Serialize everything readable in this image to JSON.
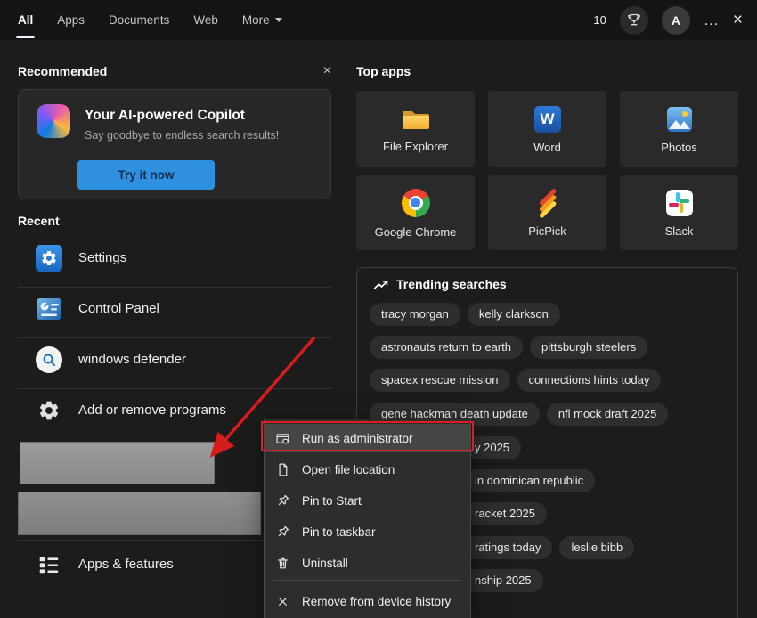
{
  "topbar": {
    "tabs": [
      "All",
      "Apps",
      "Documents",
      "Web",
      "More"
    ],
    "rewards_count": "10",
    "avatar_letter": "A",
    "ellipsis_glyph": "…",
    "close_glyph": "×"
  },
  "left": {
    "recommended_title": "Recommended",
    "recommended_close_glyph": "×",
    "copilot": {
      "title": "Your AI-powered Copilot",
      "subtitle": "Say goodbye to endless search results!",
      "button_label": "Try it now"
    },
    "recent_title": "Recent",
    "recent_items": [
      {
        "label": "Settings",
        "icon": "settings-icon"
      },
      {
        "label": "Control Panel",
        "icon": "control-panel-icon"
      },
      {
        "label": "windows defender",
        "icon": "search-icon"
      },
      {
        "label": "Add or remove programs",
        "icon": "gear-icon"
      }
    ],
    "apps_features_label": "Apps & features"
  },
  "right": {
    "top_apps_title": "Top apps",
    "apps": [
      {
        "label": "File Explorer",
        "icon": "folder-icon"
      },
      {
        "label": "Word",
        "icon": "word-icon",
        "letter": "W"
      },
      {
        "label": "Photos",
        "icon": "photos-icon"
      },
      {
        "label": "Google Chrome",
        "icon": "chrome-icon"
      },
      {
        "label": "PicPick",
        "icon": "picpick-icon"
      },
      {
        "label": "Slack",
        "icon": "slack-icon"
      }
    ],
    "trending": {
      "title": "Trending searches",
      "rows": [
        [
          "tracy morgan",
          "kelly clarkson"
        ],
        [
          "astronauts return to earth",
          "pittsburgh steelers"
        ],
        [
          "spacex rescue mission",
          "connections hints today"
        ],
        [
          "gene hackman death update",
          "nfl mock draft 2025"
        ],
        [
          "y 2025"
        ],
        [
          "in dominican republic"
        ],
        [
          "racket 2025"
        ],
        [
          "ratings today",
          "leslie bibb"
        ],
        [
          "nship 2025"
        ]
      ]
    }
  },
  "context_menu": {
    "items": [
      {
        "label": "Run as administrator",
        "icon": "run-as-administrator-icon",
        "highlighted": true
      },
      {
        "label": "Open file location",
        "icon": "open-file-location-icon"
      },
      {
        "label": "Pin to Start",
        "icon": "pin-icon"
      },
      {
        "label": "Pin to taskbar",
        "icon": "pin-icon"
      },
      {
        "label": "Uninstall",
        "icon": "trash-icon"
      },
      {
        "label": "Remove from device history",
        "icon": "remove-icon"
      }
    ]
  },
  "colors": {
    "accent_blue": "#2e90de",
    "annotation_red": "#db1f1f",
    "background": "#1c1c1c",
    "tile_background": "#2a2a2a"
  }
}
